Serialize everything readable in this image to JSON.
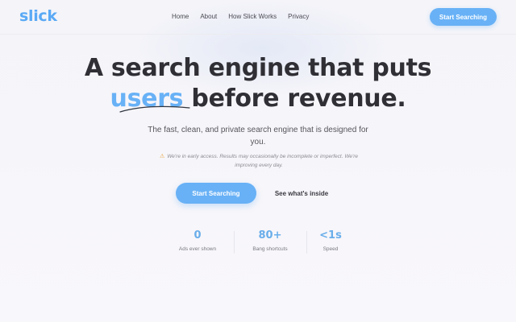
{
  "nav": {
    "logo": "slick",
    "links": [
      "Home",
      "About",
      "How Slick Works",
      "Privacy"
    ],
    "cta": "Start Searching"
  },
  "hero": {
    "line1": "A search engine that puts",
    "accent_word": "users",
    "line2_rest": " before revenue.",
    "subtitle": "The fast, clean, and private search engine that is designed for you.",
    "notice_icon": "warning-icon",
    "notice": "We're in early access. Results may occasionally be incomplete or imperfect. We're improving every day.",
    "primary_button": "Start Searching",
    "secondary_button": "See what's inside"
  },
  "stats": [
    {
      "value": "0",
      "label": "Ads ever shown"
    },
    {
      "value": "80+",
      "label": "Bang shortcuts"
    },
    {
      "value": "<1s",
      "label": "Speed"
    }
  ],
  "colors": {
    "accent": "#68b1f6",
    "text": "#2f2f35"
  }
}
